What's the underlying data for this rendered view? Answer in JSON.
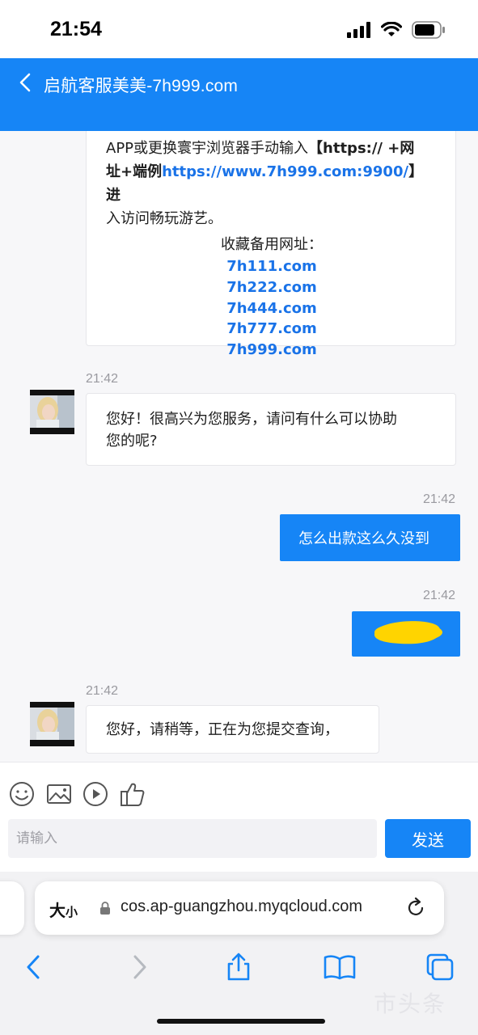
{
  "status_bar": {
    "time": "21:54"
  },
  "header": {
    "title": "启航客服美美-7h999.com"
  },
  "chat": {
    "notice": {
      "line1_a": "APP或更换寰宇浏览器手动输入",
      "line1_b": "【https:// +网",
      "line2_a": "址+端例",
      "line2_link": "https://www.7h999.com:9900/",
      "line2_b": "】进",
      "line3": "入访问畅玩游艺。",
      "bookmark_title": "收藏备用网址：",
      "bookmarks": [
        "7h111.com",
        "7h222.com",
        "7h444.com",
        "7h777.com",
        "7h999.com"
      ]
    },
    "messages": [
      {
        "side": "left",
        "time": "21:42",
        "text_line1": "您好！很高兴为您服务，请问有什么可以协助",
        "text_line2": "您的呢?"
      },
      {
        "side": "right",
        "time": "21:42",
        "text": "怎么出款这么久没到"
      },
      {
        "side": "right",
        "time": "21:42",
        "text": ""
      },
      {
        "side": "left",
        "time": "21:42",
        "text": "您好，请稍等，正在为您提交查询，"
      }
    ]
  },
  "toolbar": {
    "icons": [
      "emoji-icon",
      "image-icon",
      "video-icon",
      "thumbs-up-icon"
    ],
    "input_placeholder": "请输入",
    "send_label": "发送"
  },
  "safari": {
    "text_size_label_big": "大",
    "text_size_label_small": "小",
    "url": "cos.ap-guangzhou.myqcloud.com"
  },
  "watermark": {
    "text": "市头条"
  },
  "colors": {
    "accent": "#1685f6",
    "link": "#1a73e8",
    "redaction": "#ffd400"
  }
}
